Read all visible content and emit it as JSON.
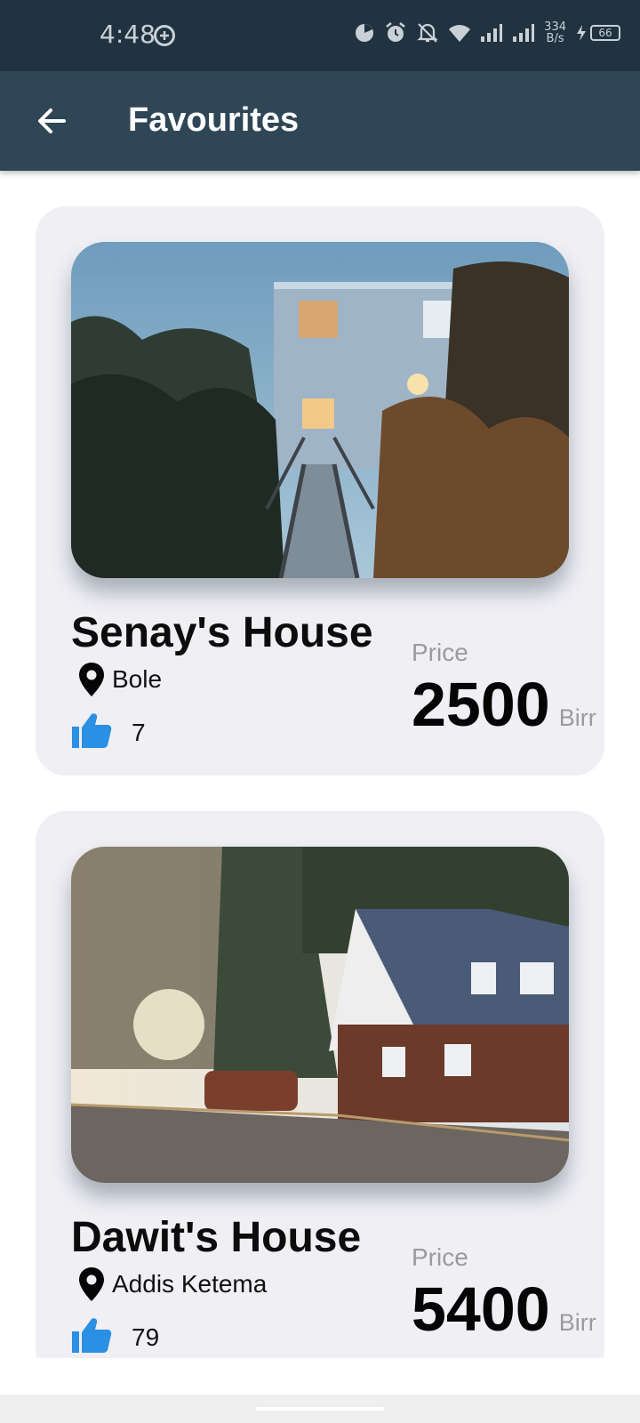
{
  "status_bar": {
    "time": "4:48",
    "net_speed_value": "334",
    "net_speed_unit": "B/s",
    "battery": "66",
    "icons": [
      "data-saver-icon",
      "pie-icon",
      "alarm-icon",
      "bell-off-icon",
      "wifi-icon",
      "signal-icon",
      "signal-icon",
      "battery-charging-icon"
    ]
  },
  "app_bar": {
    "title": "Favourites",
    "back_icon": "arrow-back-icon"
  },
  "listings": [
    {
      "name": "Senay's House",
      "location": "Bole",
      "likes": "7",
      "price_label": "Price",
      "price": "2500",
      "currency": "Birr"
    },
    {
      "name": "Dawit's House",
      "location": "Addis Ketema",
      "likes": "79",
      "price_label": "Price",
      "price": "5400",
      "currency": "Birr"
    }
  ],
  "colors": {
    "status_bar": "#213240",
    "app_bar": "#2f4656",
    "card_bg": "#efeff4",
    "like_icon": "#2b8fe3"
  }
}
